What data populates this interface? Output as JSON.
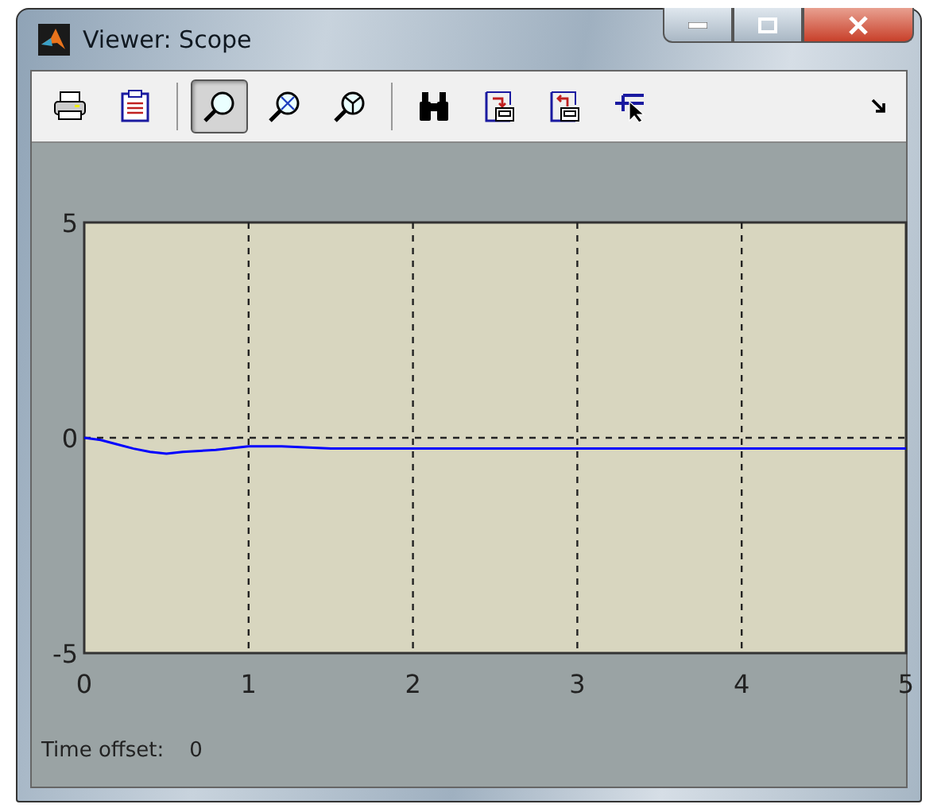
{
  "window": {
    "title": "Viewer: Scope"
  },
  "toolbar": [
    {
      "kind": "print",
      "selected": false
    },
    {
      "kind": "parameters",
      "selected": false
    },
    {
      "kind": "separator"
    },
    {
      "kind": "zoom",
      "selected": true
    },
    {
      "kind": "zoom-x",
      "selected": false
    },
    {
      "kind": "zoom-y",
      "selected": false
    },
    {
      "kind": "separator"
    },
    {
      "kind": "autoscale",
      "selected": false
    },
    {
      "kind": "save-axes",
      "selected": false
    },
    {
      "kind": "restore-axes",
      "selected": false
    },
    {
      "kind": "float",
      "selected": false
    }
  ],
  "plot": {
    "chart_data": {
      "type": "line",
      "x": [
        0,
        0.1,
        0.2,
        0.3,
        0.4,
        0.5,
        0.6,
        0.8,
        1,
        1.2,
        1.5,
        2,
        3,
        4,
        5
      ],
      "grid": true,
      "series": [
        {
          "color": "#0000ff",
          "values": [
            0,
            -0.05,
            -0.15,
            -0.25,
            -0.33,
            -0.37,
            -0.33,
            -0.28,
            -0.2,
            -0.2,
            -0.25,
            -0.25,
            -0.25,
            -0.25,
            -0.25
          ]
        }
      ],
      "xlim": [
        0,
        5
      ],
      "ylim": [
        -5,
        5
      ],
      "xticks": [
        0,
        1,
        2,
        3,
        4,
        5
      ],
      "yticks": [
        -5,
        0,
        5
      ]
    }
  },
  "time_offset": {
    "label": "Time offset:",
    "value": "0"
  }
}
